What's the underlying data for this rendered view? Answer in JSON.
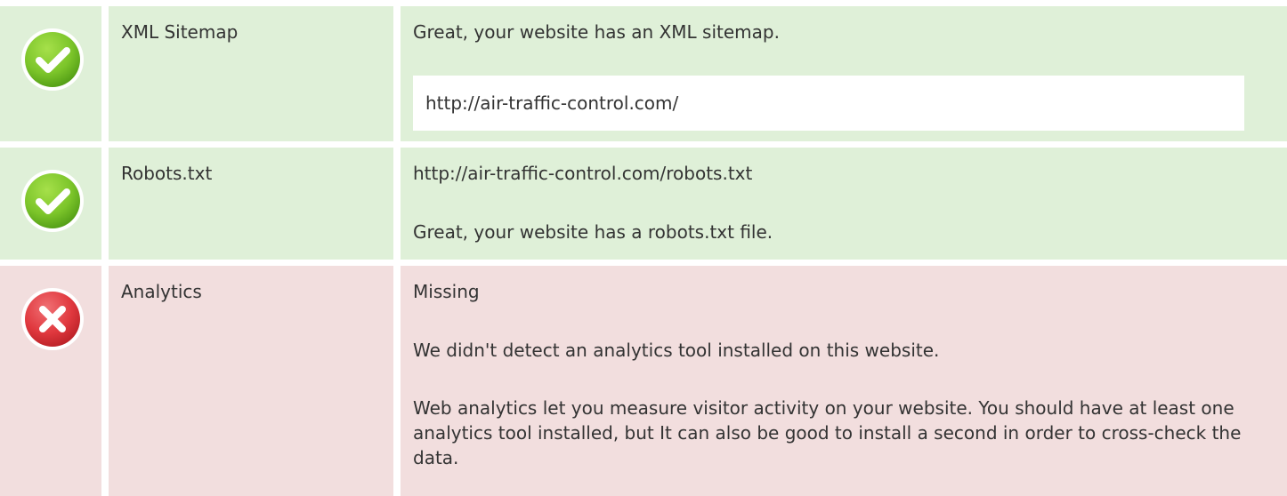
{
  "rows": [
    {
      "status": "pass",
      "icon": "check-circle-icon",
      "name": "XML Sitemap",
      "message": "Great, your website has an XML sitemap.",
      "sitemap_url": "http://air-traffic-control.com/"
    },
    {
      "status": "pass",
      "icon": "check-circle-icon",
      "name": "Robots.txt",
      "robots_url": "http://air-traffic-control.com/robots.txt",
      "message": "Great, your website has a robots.txt file."
    },
    {
      "status": "fail",
      "icon": "x-circle-icon",
      "name": "Analytics",
      "result": "Missing",
      "message": "We didn't detect an analytics tool installed on this website.",
      "advice": "Web analytics let you measure visitor activity on your website. You should have at least one analytics tool installed, but It can also be good to install a second in order to cross-check the data."
    }
  ],
  "colors": {
    "pass_background": "#dff0d8",
    "fail_background": "#f2dede",
    "pass_icon": "#7cc52a",
    "fail_icon": "#e0383e",
    "text": "#333333"
  }
}
